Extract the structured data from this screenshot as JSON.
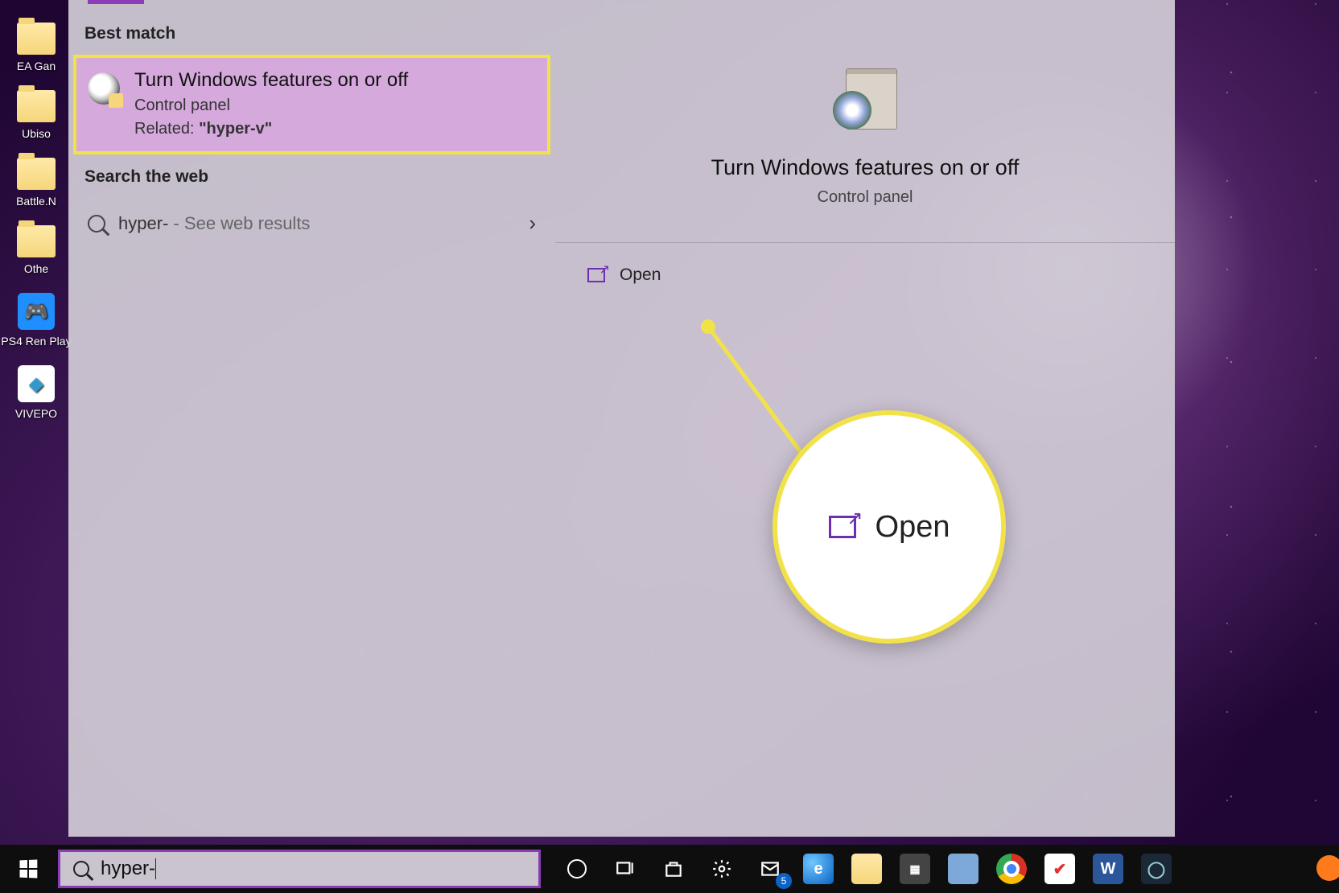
{
  "desktop": {
    "icons": [
      {
        "label": "EA Gan"
      },
      {
        "label": "Ubiso"
      },
      {
        "label": "Battle.N"
      },
      {
        "label": "Othe"
      },
      {
        "label": "PS4 Ren Play",
        "kind": "ps4"
      },
      {
        "label": "VIVEPO",
        "kind": "vive"
      }
    ]
  },
  "search": {
    "best_match_header": "Best match",
    "result": {
      "title": "Turn Windows features on or off",
      "subtitle": "Control panel",
      "related_prefix": "Related: ",
      "related_value": "\"hyper-v\""
    },
    "web_header": "Search the web",
    "web_query": "hyper-",
    "web_suffix": " - See web results",
    "detail": {
      "title": "Turn Windows features on or off",
      "subtitle": "Control panel",
      "open_label": "Open"
    }
  },
  "zoom": {
    "label": "Open"
  },
  "taskbar": {
    "query": "hyper-",
    "mail_badge": "5"
  }
}
